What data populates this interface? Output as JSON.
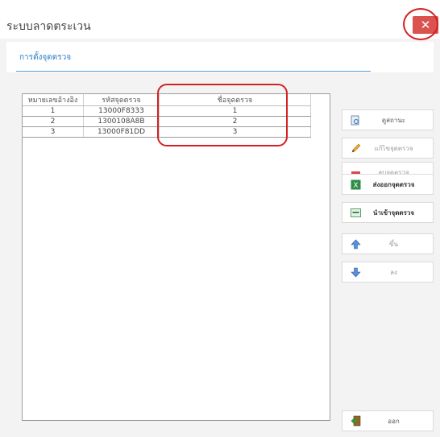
{
  "window": {
    "title": "ระบบลาดตระเวน",
    "close_label": "✕"
  },
  "tabs": [
    {
      "label": "การตั้งจุดตรวจ"
    }
  ],
  "table": {
    "columns": [
      "หมายเลขอ้างอิง",
      "รหัสจุดตรวจ",
      "ชื่อจุดตรวจ"
    ],
    "rows": [
      [
        "1",
        "13000F8333",
        "1"
      ],
      [
        "2",
        "1300108A8B",
        "2"
      ],
      [
        "3",
        "13000F81DD",
        "3"
      ]
    ]
  },
  "actions": [
    {
      "label": "ดูสถานะ",
      "icon": "view-icon",
      "enabled": true
    },
    {
      "label": "แก้ไขจุดตรวจ",
      "icon": "pencil-icon",
      "enabled": false
    },
    {
      "label": "ลบจุดตรวจ",
      "icon": "minus-icon",
      "enabled": false
    },
    {
      "label": "ส่งออกจุดตรวจ",
      "icon": "excel-icon",
      "enabled": true
    },
    {
      "label": "นำเข้าจุดตรวจ",
      "icon": "import-icon",
      "enabled": true
    },
    {
      "label": "ขึ้น",
      "icon": "arrow-up-icon",
      "enabled": false
    },
    {
      "label": "ลง",
      "icon": "arrow-down-icon",
      "enabled": false
    },
    {
      "label": "ออก",
      "icon": "exit-icon",
      "enabled": true
    }
  ],
  "colors": {
    "accent": "#2a7fc4",
    "close": "#d9534f",
    "annotation": "#d42020"
  }
}
